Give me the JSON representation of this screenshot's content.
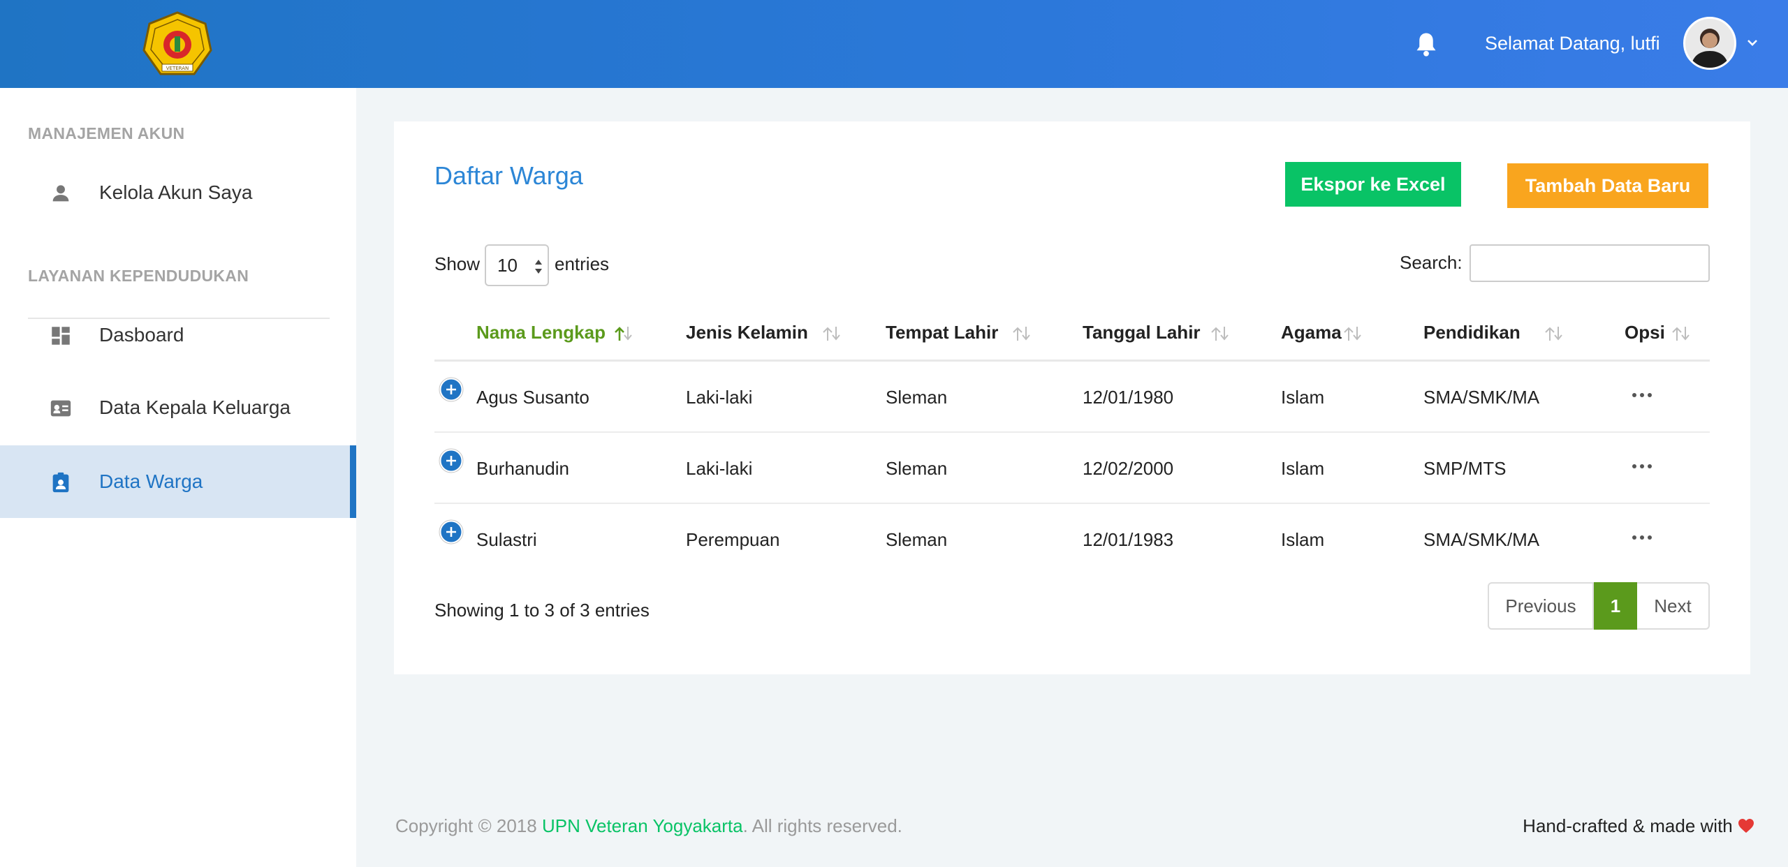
{
  "header": {
    "welcome": "Selamat Datang, lutfi",
    "logo_text": "UNIVERSITAS PEMBANGUNAN NASIONAL VETERAN"
  },
  "sidebar": {
    "sections": [
      {
        "title": "MANAJEMEN AKUN",
        "items": [
          {
            "label": "Kelola Akun Saya",
            "icon": "person-icon"
          }
        ]
      },
      {
        "title": "LAYANAN KEPENDUDUKAN",
        "items": [
          {
            "label": "Dasboard",
            "icon": "dashboard-icon"
          },
          {
            "label": "Data Kepala Keluarga",
            "icon": "id-card-icon"
          },
          {
            "label": "Data Warga",
            "icon": "clipboard-user-icon",
            "active": true
          }
        ]
      }
    ]
  },
  "main": {
    "title": "Daftar Warga",
    "buttons": {
      "export": "Ekspor ke Excel",
      "add": "Tambah Data Baru"
    },
    "length": {
      "show": "Show",
      "value": "10",
      "entries": "entries"
    },
    "search": {
      "label": "Search:",
      "value": ""
    },
    "table": {
      "columns": [
        "Nama Lengkap",
        "Jenis Kelamin",
        "Tempat Lahir",
        "Tanggal Lahir",
        "Agama",
        "Pendidikan",
        "Opsi"
      ],
      "sorted_column": "Nama Lengkap",
      "rows": [
        [
          "Agus Susanto",
          "Laki-laki",
          "Sleman",
          "12/01/1980",
          "Islam",
          "SMA/SMK/MA"
        ],
        [
          "Burhanudin",
          "Laki-laki",
          "Sleman",
          "12/02/2000",
          "Islam",
          "SMP/MTS"
        ],
        [
          "Sulastri",
          "Perempuan",
          "Sleman",
          "12/01/1983",
          "Islam",
          "SMA/SMK/MA"
        ]
      ]
    },
    "info": "Showing 1 to 3 of 3 entries",
    "pagination": {
      "previous": "Previous",
      "current": "1",
      "next": "Next"
    }
  },
  "footer": {
    "copyright_prefix": "Copyright © 2018 ",
    "brand": "UPN Veteran Yogyakarta",
    "copyright_suffix": ". All rights reserved.",
    "crafted": "Hand-crafted & made with"
  },
  "colors": {
    "header_start": "#1f74c4",
    "header_end": "#3a7ce8",
    "title_blue": "#2c86d6",
    "export_green": "#09c366",
    "add_orange": "#f9a51e",
    "sort_green": "#5b9a1c",
    "heart_red": "#e53935"
  }
}
